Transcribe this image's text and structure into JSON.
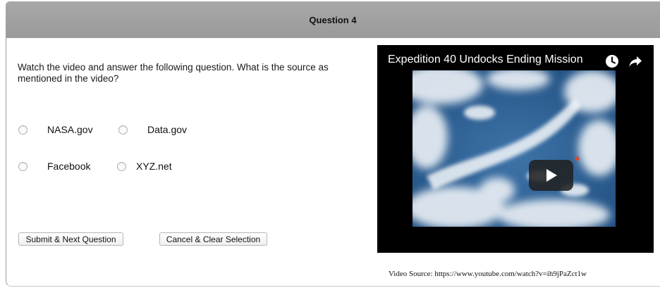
{
  "header": {
    "title": "Question 4"
  },
  "question": {
    "prompt": "Watch the video and answer the following question. What is the source as mentioned in the video?",
    "options": [
      "NASA.gov",
      "Data.gov",
      "Facebook",
      "XYZ.net"
    ]
  },
  "buttons": {
    "submit_label": "Submit & Next Question",
    "cancel_label": "Cancel & Clear Selection"
  },
  "video": {
    "title": "Expedition 40 Undocks Ending Mission",
    "icons": [
      "clock-icon",
      "share-icon",
      "play-icon"
    ]
  },
  "source_text": "Video Source: https://www.youtube.com/watch?v=ih9jPaZct1w",
  "colors": {
    "header_bg": "#9e9e9e",
    "video_bg": "#000000",
    "play_button": "#212121"
  }
}
